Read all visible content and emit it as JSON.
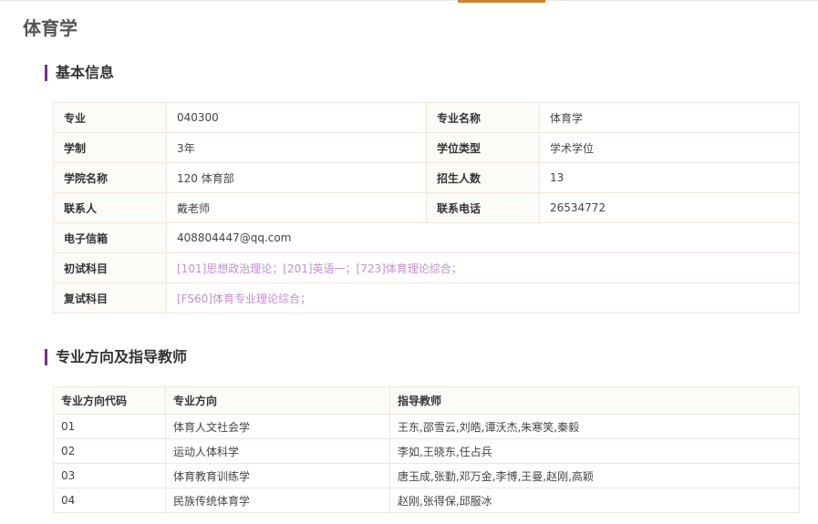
{
  "page": {
    "title": "体育学"
  },
  "basic_info": {
    "section_title": "基本信息",
    "major_label": "专业",
    "major_value": "040300",
    "major_name_label": "专业名称",
    "major_name_value": "体育学",
    "duration_label": "学制",
    "duration_value": "3年",
    "degree_type_label": "学位类型",
    "degree_type_value": "学术学位",
    "college_label": "学院名称",
    "college_value": "120 体育部",
    "enrollment_label": "招生人数",
    "enrollment_value": "13",
    "contact_label": "联系人",
    "contact_value": "戴老师",
    "phone_label": "联系电话",
    "phone_value": "26534772",
    "email_label": "电子信箱",
    "email_value": "408804447@qq.com",
    "prelim_label": "初试科目",
    "prelim_value": "[101]思想政治理论；[201]英语一；[723]体育理论综合；",
    "retest_label": "复试科目",
    "retest_value": "[FS60]体育专业理论综合；"
  },
  "directions": {
    "section_title": "专业方向及指导教师",
    "headers": [
      "专业方向代码",
      "专业方向",
      "指导教师"
    ],
    "rows": [
      {
        "code": "01",
        "name": "体育人文社会学",
        "teachers": "王东,邵雪云,刘皓,谭沃杰,朱寒笑,秦毅"
      },
      {
        "code": "02",
        "name": "运动人体科学",
        "teachers": "李如,王晓东,任占兵"
      },
      {
        "code": "03",
        "name": "体育教育训练学",
        "teachers": "唐玉成,张勤,邓万金,李博,王曼,赵刚,高颖"
      },
      {
        "code": "04",
        "name": "民族传统体育学",
        "teachers": "赵刚,张得保,邱服冰"
      }
    ]
  },
  "colors": {
    "accent_purple": "#7b2d8e",
    "top_tab_accent": "#c9823a",
    "link_purple": "#c48fd2"
  }
}
